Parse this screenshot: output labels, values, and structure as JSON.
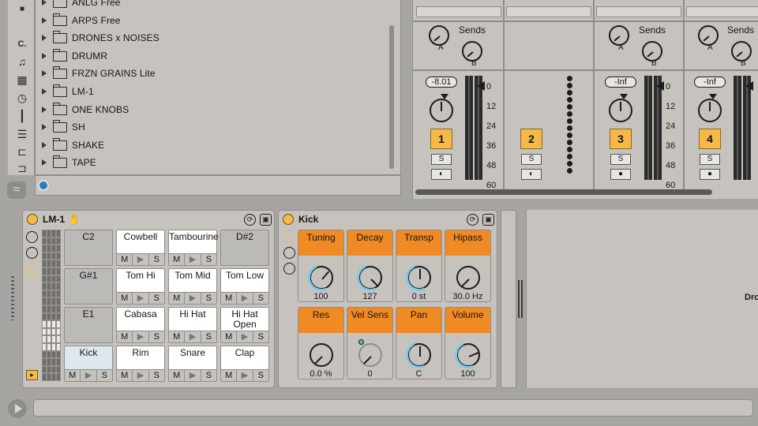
{
  "browser": {
    "sidebar_letter": "C.",
    "folders": [
      "ANLG Free",
      "ARPS Free",
      "DRONES x NOISES",
      "DRUMR",
      "FRZN GRAINS Lite",
      "LM-1",
      "ONE KNOBS",
      "SH",
      "SHAKE",
      "TAPE"
    ]
  },
  "mixer": {
    "sends_label": "Sends",
    "send_a": "A",
    "send_b": "B",
    "db_ticks": [
      "0",
      "12",
      "24",
      "36",
      "48",
      "60"
    ],
    "channels": [
      {
        "volume": "-8.01",
        "track_number": "1",
        "solo": "S"
      },
      {
        "volume": "",
        "track_number": "2",
        "solo": "S"
      },
      {
        "volume": "-Inf",
        "track_number": "3",
        "solo": "S"
      },
      {
        "volume": "-Inf",
        "track_number": "4",
        "solo": "S"
      }
    ]
  },
  "drum_rack": {
    "title": "LM-1",
    "pads": [
      {
        "name": "C2",
        "m": "",
        "s": ""
      },
      {
        "name": "Cowbell",
        "m": "M",
        "s": "S"
      },
      {
        "name": "Tambourine",
        "m": "M",
        "s": "S"
      },
      {
        "name": "D#2",
        "m": "",
        "s": ""
      },
      {
        "name": "G#1",
        "m": "",
        "s": ""
      },
      {
        "name": "Tom Hi",
        "m": "M",
        "s": "S"
      },
      {
        "name": "Tom Mid",
        "m": "M",
        "s": "S"
      },
      {
        "name": "Tom Low",
        "m": "M",
        "s": "S"
      },
      {
        "name": "E1",
        "m": "",
        "s": ""
      },
      {
        "name": "Cabasa",
        "m": "M",
        "s": "S"
      },
      {
        "name": "Hi Hat",
        "m": "M",
        "s": "S"
      },
      {
        "name": "Hi Hat Open",
        "m": "M",
        "s": "S"
      },
      {
        "name": "Kick",
        "m": "M",
        "s": "S"
      },
      {
        "name": "Rim",
        "m": "M",
        "s": "S"
      },
      {
        "name": "Snare",
        "m": "M",
        "s": "S"
      },
      {
        "name": "Clap",
        "m": "M",
        "s": "S"
      }
    ]
  },
  "kick_device": {
    "title": "Kick",
    "macros": [
      {
        "label": "Tuning",
        "value": "100",
        "level": 0.65
      },
      {
        "label": "Decay",
        "value": "127",
        "level": 1.0
      },
      {
        "label": "Transp",
        "value": "0 st",
        "level": 0.5
      },
      {
        "label": "Hipass",
        "value": "30.0 Hz",
        "level": 0.0
      },
      {
        "label": "Res",
        "value": "0.0 %",
        "level": 0.0
      },
      {
        "label": "Vel Sens",
        "value": "0",
        "level": 0.0
      },
      {
        "label": "Pan",
        "value": "C",
        "level": 0.5
      },
      {
        "label": "Volume",
        "value": "100",
        "level": 0.75
      }
    ]
  },
  "dropzone_text": "Dro",
  "colors": {
    "accent": "#f5b94a",
    "macro_header": "#f08a24",
    "arc": "#7cc8e6"
  }
}
